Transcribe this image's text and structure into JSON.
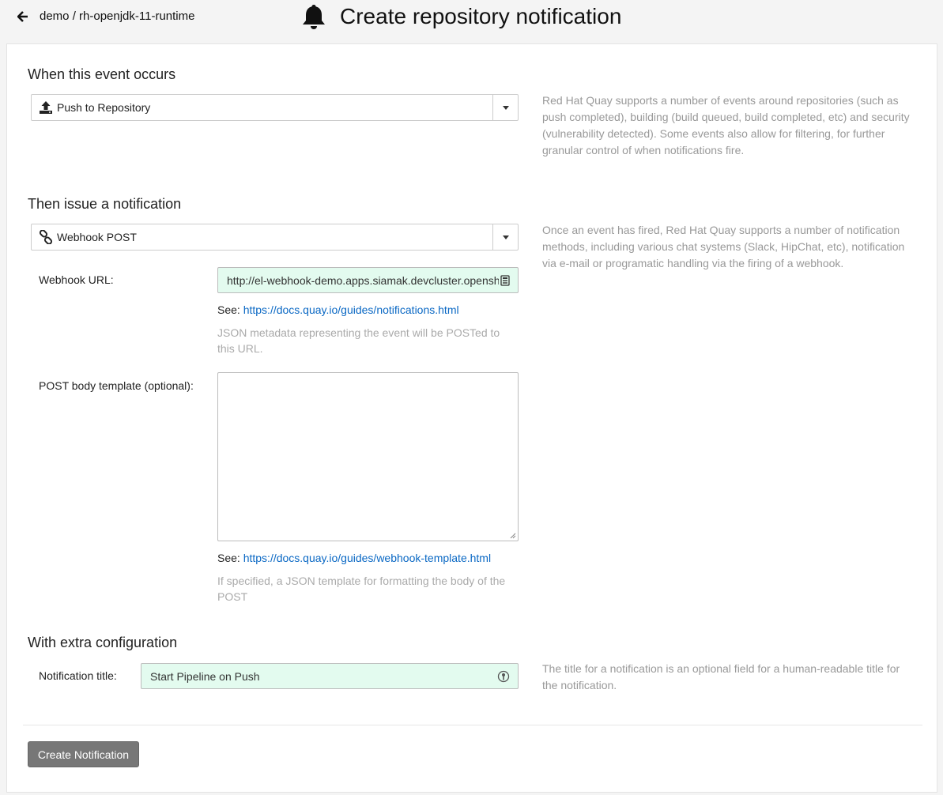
{
  "header": {
    "breadcrumb": "demo / rh-openjdk-11-runtime",
    "title": "Create repository notification"
  },
  "event_section": {
    "title": "When this event occurs",
    "selected": "Push to Repository",
    "help": "Red Hat Quay supports a number of events around repositories (such as push completed), building (build queued, build completed, etc) and security (vulnerability detected). Some events also allow for filtering, for further granular control of when notifications fire."
  },
  "method_section": {
    "title": "Then issue a notification",
    "selected": "Webhook POST",
    "help": "Once an event has fired, Red Hat Quay supports a number of notification methods, including various chat systems (Slack, HipChat, etc), notification via e-mail or programatic handling via the firing of a webhook.",
    "webhook_url_label": "Webhook URL:",
    "webhook_url_value": "http://el-webhook-demo.apps.siamak.devcluster.openshift.com",
    "see_label": "See:",
    "webhook_docs_link": "https://docs.quay.io/guides/notifications.html",
    "webhook_hint": "JSON metadata representing the event will be POSTed to this URL.",
    "body_label": "POST body template (optional):",
    "body_value": "",
    "template_docs_link": "https://docs.quay.io/guides/webhook-template.html",
    "template_hint": "If specified, a JSON template for formatting the body of the POST"
  },
  "config_section": {
    "title": "With extra configuration",
    "notif_title_label": "Notification title:",
    "notif_title_value": "Start Pipeline on Push",
    "help": "The title for a notification is an optional field for a human-readable title for the notification."
  },
  "actions": {
    "create_label": "Create Notification"
  }
}
